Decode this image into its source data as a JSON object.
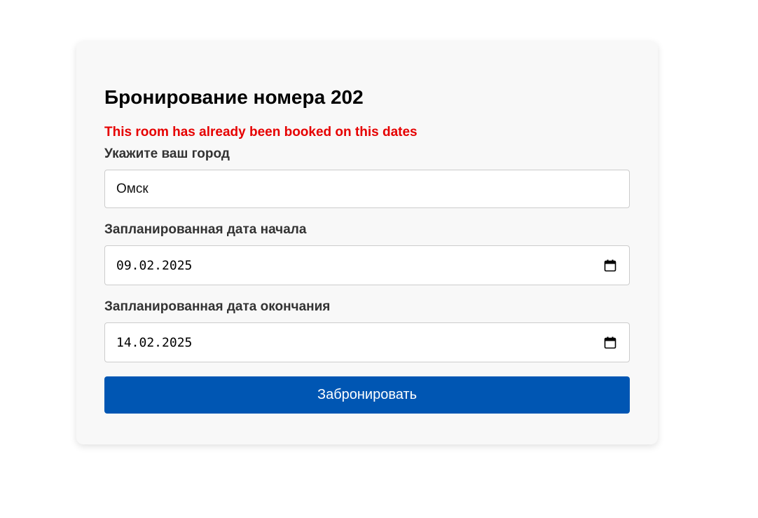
{
  "form": {
    "title": "Бронирование номера 202",
    "error_message": "This room has already been booked on this dates",
    "city": {
      "label": "Укажите ваш город",
      "value": "Омск"
    },
    "start_date": {
      "label": "Запланированная дата начала",
      "value": "09.02.2025",
      "icon": "calendar-icon"
    },
    "end_date": {
      "label": "Запланированная дата окончания",
      "value": "14.02.2025",
      "icon": "calendar-icon"
    },
    "submit_label": "Забронировать"
  },
  "colors": {
    "error": "#e60000",
    "button": "#0056b3",
    "card_background": "#f8f8f8"
  }
}
